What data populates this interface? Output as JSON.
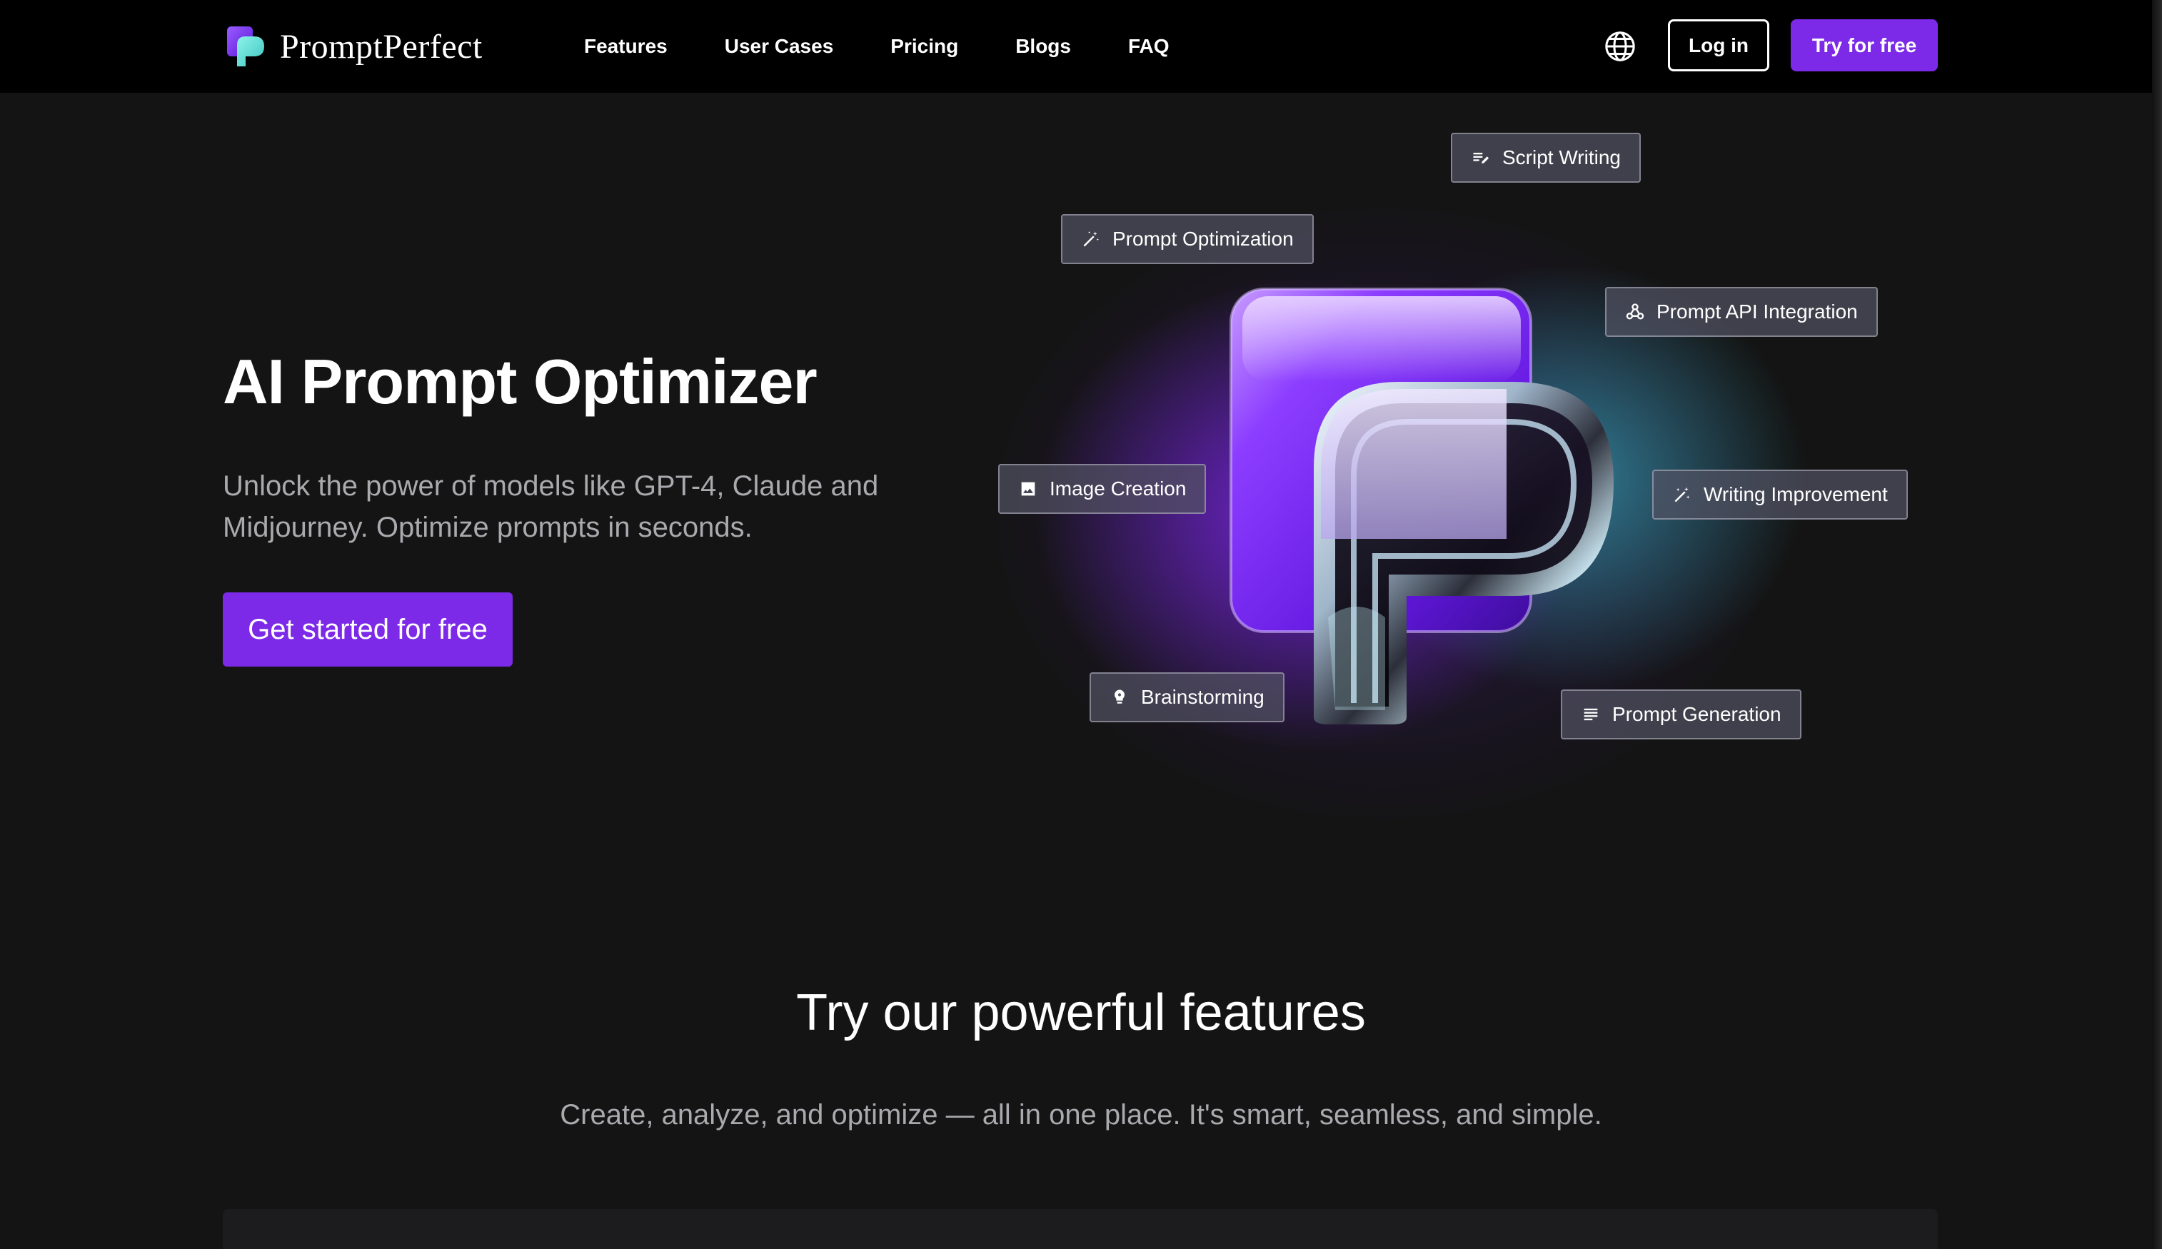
{
  "brand": {
    "name": "PromptPerfect"
  },
  "nav": {
    "links": [
      "Features",
      "User Cases",
      "Pricing",
      "Blogs",
      "FAQ"
    ],
    "login_label": "Log in",
    "try_label": "Try for free"
  },
  "hero": {
    "title": "AI Prompt Optimizer",
    "subtitle": "Unlock the power of models like GPT-4, Claude and Midjourney. Optimize prompts in seconds.",
    "cta_label": "Get started for free"
  },
  "tags": {
    "script_writing": "Script Writing",
    "prompt_optimization": "Prompt Optimization",
    "api_integration": "Prompt API Integration",
    "image_creation": "Image Creation",
    "writing_improvement": "Writing Improvement",
    "brainstorming": "Brainstorming",
    "prompt_generation": "Prompt Generation"
  },
  "features": {
    "title": "Try our powerful features",
    "subtitle": "Create, analyze, and optimize — all in one place. It's smart, seamless, and simple."
  },
  "colors": {
    "accent": "#7c2ae8",
    "nav_bg": "#000000",
    "page_bg": "#141414",
    "muted_text": "#a9a9ae",
    "glow_purple": "#8828ff",
    "glow_cyan": "#3cbed7"
  },
  "icons": {
    "globe": "globe-icon",
    "script_writing": "edit-lines-icon",
    "prompt_optimization": "magic-wand-icon",
    "api_integration": "webhook-icon",
    "image_creation": "image-icon",
    "writing_improvement": "auto-fix-icon",
    "brainstorming": "lightbulb-icon",
    "prompt_generation": "notes-icon"
  }
}
